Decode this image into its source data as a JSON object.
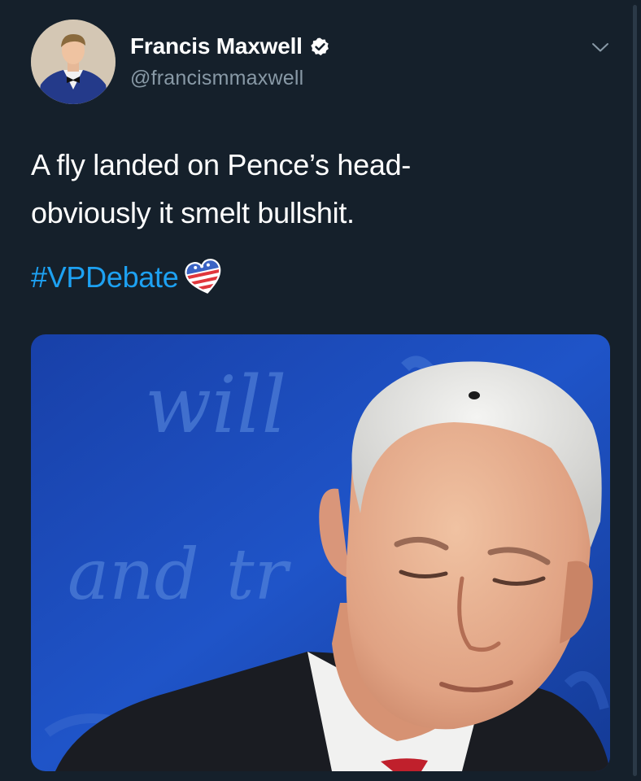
{
  "author": {
    "display_name": "Francis Maxwell",
    "handle": "@francismmaxwell",
    "verified": true,
    "verified_icon": "verified-badge-icon",
    "avatar_description": "profile-photo"
  },
  "menu": {
    "icon": "chevron-down-icon"
  },
  "tweet": {
    "text_line_1": "A fly landed on Pence’s head-",
    "text_line_2": "obviously it smelt bullshit.",
    "hashtag": "#VPDebate",
    "hashflag_icon": "american-flag-heart-icon"
  },
  "media": {
    "background_words": [
      "will",
      "and",
      "tr"
    ]
  },
  "colors": {
    "background": "#15202b",
    "text": "#ffffff",
    "secondary_text": "#8899a6",
    "link": "#1da1f2",
    "verified": "#ffffff"
  }
}
